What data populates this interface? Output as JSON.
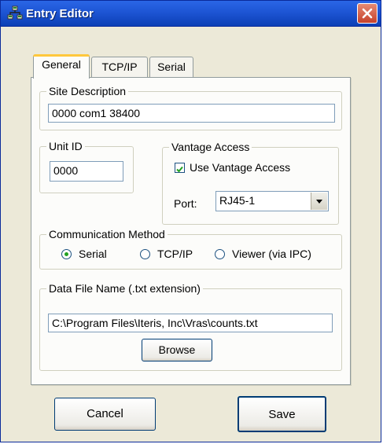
{
  "window": {
    "title": "Entry Editor",
    "icon": "network-nodes-icon",
    "close_icon": "close-icon",
    "close_color": "#c6412a"
  },
  "tabs": [
    {
      "label": "General",
      "active": true
    },
    {
      "label": "TCP/IP",
      "active": false
    },
    {
      "label": "Serial",
      "active": false
    }
  ],
  "site_description": {
    "legend": "Site Description",
    "value": "0000 com1 38400"
  },
  "unit_id": {
    "legend": "Unit ID",
    "value": "0000"
  },
  "vantage_access": {
    "legend": "Vantage Access",
    "checkbox_label": "Use Vantage Access",
    "checked": true,
    "port_label": "Port:",
    "port_value": "RJ45-1"
  },
  "communication_method": {
    "legend": "Communication Method",
    "options": [
      {
        "label": "Serial",
        "selected": true
      },
      {
        "label": "TCP/IP",
        "selected": false
      },
      {
        "label": "Viewer (via IPC)",
        "selected": false
      }
    ]
  },
  "data_file": {
    "legend": "Data File Name (.txt extension)",
    "value": "C:\\Program Files\\Iteris, Inc\\Vras\\counts.txt",
    "browse_label": "Browse"
  },
  "buttons": {
    "cancel_label": "Cancel",
    "save_label": "Save"
  }
}
